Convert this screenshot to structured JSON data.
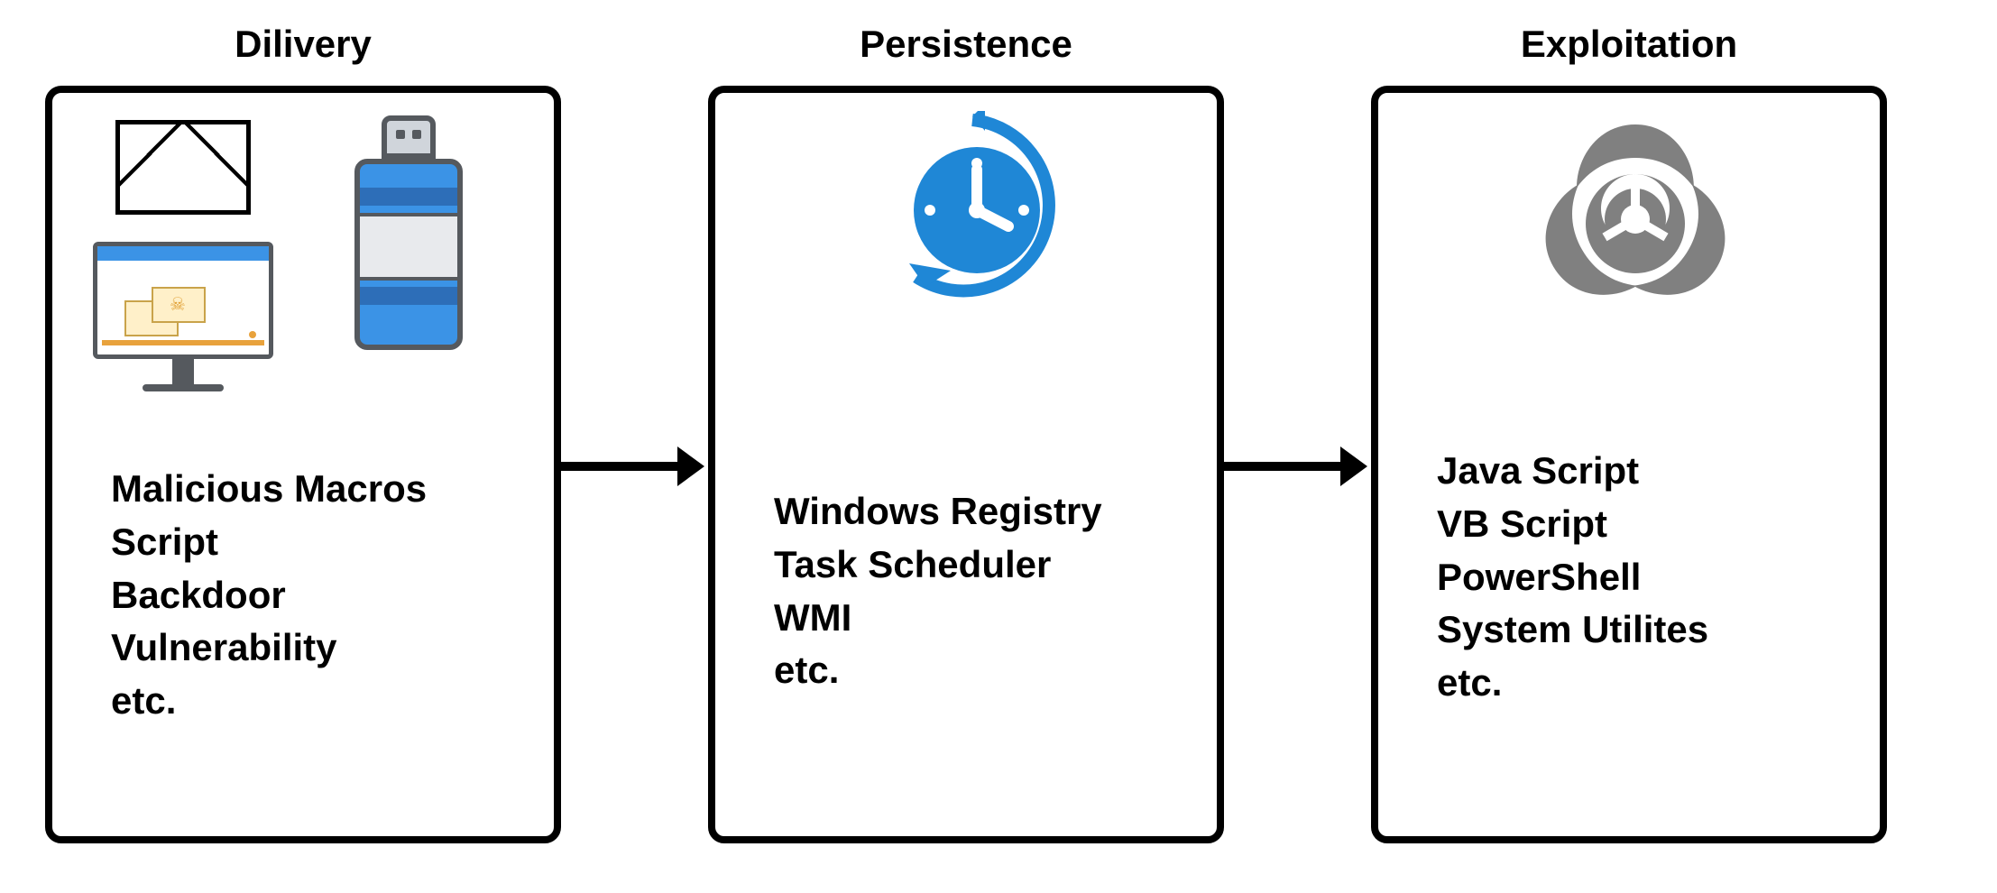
{
  "stages": [
    {
      "title": "Dilivery",
      "items": [
        "Malicious Macros",
        "Script",
        "Backdoor",
        "Vulnerability",
        "etc."
      ],
      "icons": [
        "envelope-icon",
        "usb-drive-icon",
        "infected-computer-icon"
      ]
    },
    {
      "title": "Persistence",
      "items": [
        "Windows Registry",
        "Task Scheduler",
        "WMI",
        "etc."
      ],
      "icons": [
        "clock-scheduler-icon"
      ]
    },
    {
      "title": "Exploitation",
      "items": [
        "Java Script",
        "VB Script",
        "PowerShell",
        "System Utilites",
        "etc."
      ],
      "icons": [
        "biohazard-icon"
      ]
    }
  ],
  "colors": {
    "accent_blue": "#1f87d6",
    "icon_gray": "#808080",
    "usb_blue": "#3b93e6",
    "border": "#000000"
  }
}
